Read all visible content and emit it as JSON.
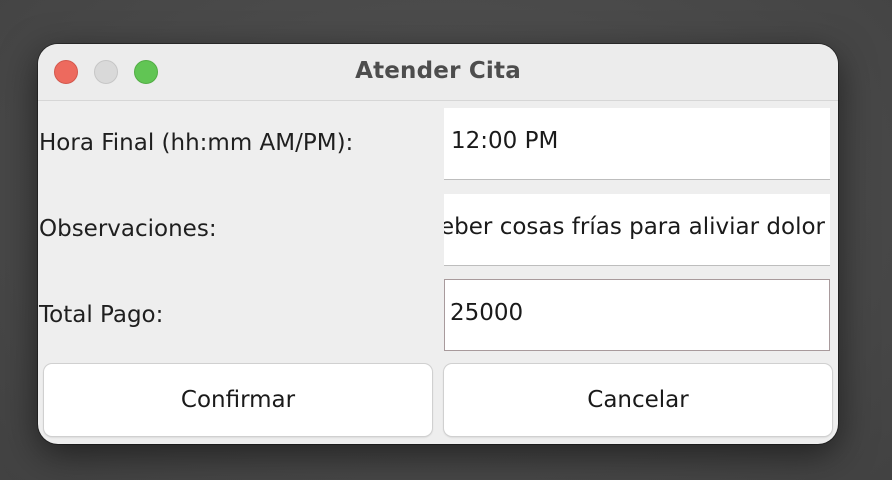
{
  "window": {
    "title": "Atender Cita"
  },
  "form": {
    "hora_final": {
      "label": "Hora Final (hh:mm AM/PM):",
      "value": "12:00 PM"
    },
    "observaciones": {
      "label": "Observaciones:",
      "value": "Beber cosas frías para aliviar dolor"
    },
    "total_pago": {
      "label": "Total Pago:",
      "value": "25000"
    }
  },
  "buttons": {
    "confirm_label": "Confirmar",
    "cancel_label": "Cancelar"
  },
  "colors": {
    "close": "#ed6a5e",
    "minimize": "#d9d9d9",
    "maximize": "#61c554",
    "focus_border": "#a89a9c"
  }
}
